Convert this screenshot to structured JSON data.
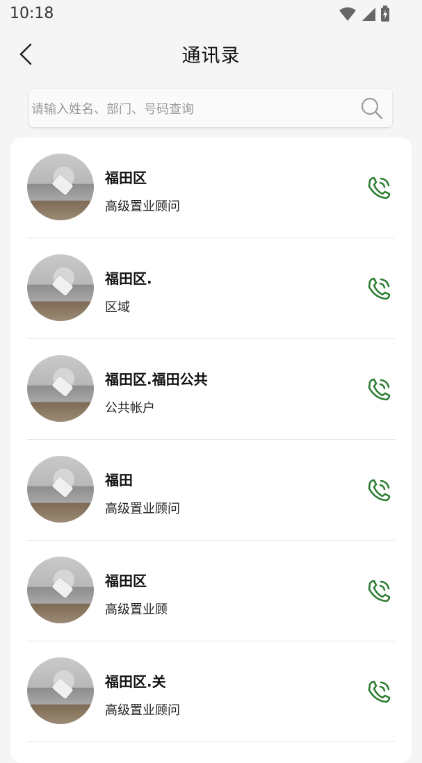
{
  "status_bar": {
    "time": "10:18"
  },
  "header": {
    "title": "通讯录"
  },
  "search": {
    "placeholder": "请输入姓名、部门、号码查询"
  },
  "contacts": [
    {
      "name": "福田区",
      "role": "高级置业顾问"
    },
    {
      "name": "福田区.",
      "role": "区域"
    },
    {
      "name": "福田区.福田公共",
      "role": "公共帐户"
    },
    {
      "name": "福田",
      "role": "高级置业顾问"
    },
    {
      "name": "福田区",
      "role": "高级置业顾"
    },
    {
      "name": "福田区.关",
      "role": "高级置业顾问"
    }
  ],
  "colors": {
    "accent": "#2e7d32",
    "background": "#f5f5f5"
  }
}
